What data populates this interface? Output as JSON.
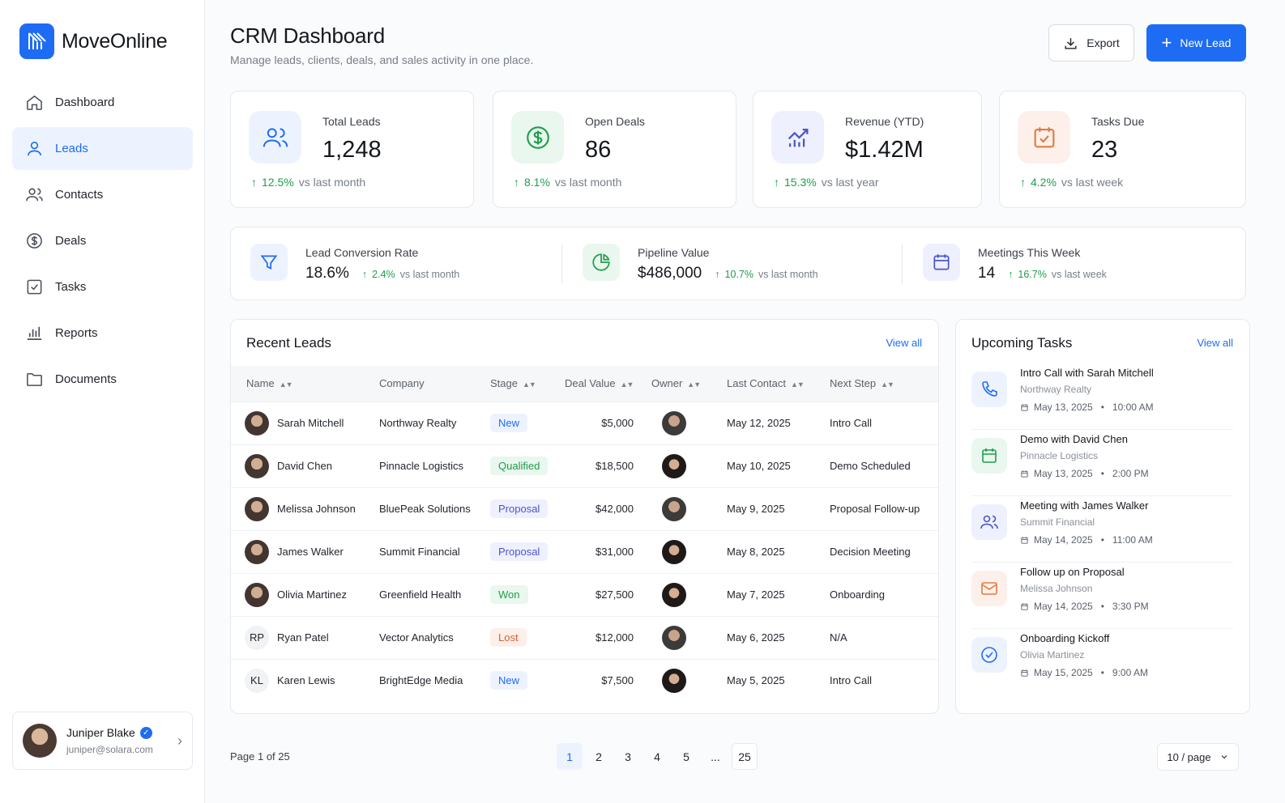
{
  "app": {
    "name": "MoveOnline"
  },
  "sidebar": {
    "items": [
      {
        "label": "Dashboard",
        "icon": "home-icon"
      },
      {
        "label": "Leads",
        "icon": "user-icon",
        "active": true
      },
      {
        "label": "Contacts",
        "icon": "users-icon"
      },
      {
        "label": "Deals",
        "icon": "dollar-icon"
      },
      {
        "label": "Tasks",
        "icon": "checkbox-icon"
      },
      {
        "label": "Reports",
        "icon": "bar-chart-icon"
      },
      {
        "label": "Documents",
        "icon": "folder-icon"
      }
    ],
    "user": {
      "name": "Juniper Blake",
      "email": "juniper@solara.com"
    }
  },
  "header": {
    "title": "CRM Dashboard",
    "subtitle": "Manage leads, clients, deals, and sales activity in one place.",
    "export_label": "Export",
    "new_lead_label": "New Lead"
  },
  "stats": [
    {
      "label": "Total Leads",
      "value": "1,248",
      "change": "12.5%",
      "period": "vs last month"
    },
    {
      "label": "Open Deals",
      "value": "86",
      "change": "8.1%",
      "period": "vs last month"
    },
    {
      "label": "Revenue (YTD)",
      "value": "$1.42M",
      "change": "15.3%",
      "period": "vs last year"
    },
    {
      "label": "Tasks Due",
      "value": "23",
      "change": "4.2%",
      "period": "vs last week"
    }
  ],
  "metrics": [
    {
      "label": "Lead Conversion Rate",
      "value": "18.6%",
      "change": "2.4%",
      "period": "vs last month"
    },
    {
      "label": "Pipeline Value",
      "value": "$486,000",
      "change": "10.7%",
      "period": "vs last month"
    },
    {
      "label": "Meetings This Week",
      "value": "14",
      "change": "16.7%",
      "period": "vs last week"
    }
  ],
  "leads": {
    "title": "Recent Leads",
    "view_all": "View all",
    "columns": [
      "Name",
      "Company",
      "Stage",
      "Deal Value",
      "Owner",
      "Last Contact",
      "Next Step"
    ],
    "rows": [
      {
        "name": "Sarah Mitchell",
        "initials": "",
        "company": "Northway Realty",
        "stage": "New",
        "value": "$5,000",
        "last": "May 12, 2025",
        "next": "Intro Call"
      },
      {
        "name": "David Chen",
        "initials": "",
        "company": "Pinnacle Logistics",
        "stage": "Qualified",
        "value": "$18,500",
        "last": "May 10, 2025",
        "next": "Demo Scheduled"
      },
      {
        "name": "Melissa Johnson",
        "initials": "",
        "company": "BluePeak Solutions",
        "stage": "Proposal",
        "value": "$42,000",
        "last": "May 9, 2025",
        "next": "Proposal Follow-up"
      },
      {
        "name": "James Walker",
        "initials": "",
        "company": "Summit Financial",
        "stage": "Proposal",
        "value": "$31,000",
        "last": "May 8, 2025",
        "next": "Decision Meeting"
      },
      {
        "name": "Olivia Martinez",
        "initials": "",
        "company": "Greenfield Health",
        "stage": "Won",
        "value": "$27,500",
        "last": "May 7, 2025",
        "next": "Onboarding"
      },
      {
        "name": "Ryan Patel",
        "initials": "RP",
        "company": "Vector Analytics",
        "stage": "Lost",
        "value": "$12,000",
        "last": "May 6, 2025",
        "next": "N/A"
      },
      {
        "name": "Karen Lewis",
        "initials": "KL",
        "company": "BrightEdge Media",
        "stage": "New",
        "value": "$7,500",
        "last": "May 5, 2025",
        "next": "Intro Call"
      }
    ]
  },
  "tasks": {
    "title": "Upcoming Tasks",
    "view_all": "View all",
    "items": [
      {
        "title": "Intro Call with Sarah Mitchell",
        "sub": "Northway Realty",
        "date": "May 13, 2025",
        "time": "10:00 AM",
        "icon": "phone-icon"
      },
      {
        "title": "Demo with David Chen",
        "sub": "Pinnacle Logistics",
        "date": "May 13, 2025",
        "time": "2:00 PM",
        "icon": "calendar-icon"
      },
      {
        "title": "Meeting with James Walker",
        "sub": "Summit Financial",
        "date": "May 14, 2025",
        "time": "11:00 AM",
        "icon": "users-icon"
      },
      {
        "title": "Follow up on Proposal",
        "sub": "Melissa Johnson",
        "date": "May 14, 2025",
        "time": "3:30 PM",
        "icon": "mail-icon"
      },
      {
        "title": "Onboarding Kickoff",
        "sub": "Olivia Martinez",
        "date": "May 15, 2025",
        "time": "9:00 AM",
        "icon": "check-circle-icon"
      }
    ]
  },
  "pagination": {
    "summary": "Page 1 of 25",
    "pages": [
      "1",
      "2",
      "3",
      "4",
      "5",
      "...",
      "25"
    ],
    "per_page": "10 / page"
  },
  "colors": {
    "accent": "#1e6cf3",
    "positive": "#1e9e4a",
    "lost": "#d9602b"
  }
}
